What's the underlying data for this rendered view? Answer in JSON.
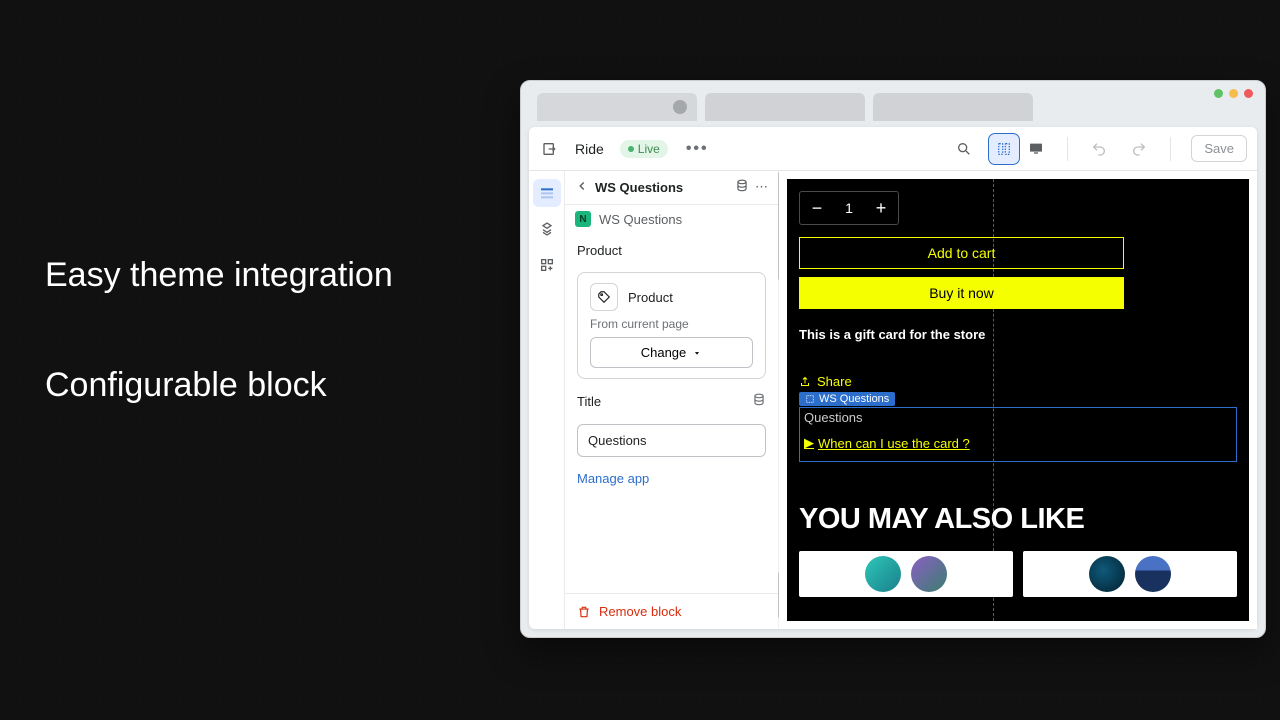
{
  "marketing": {
    "line1": "Easy theme integration",
    "line2": "Configurable block"
  },
  "toolbar": {
    "theme_name": "Ride",
    "status_label": "Live",
    "save_label": "Save"
  },
  "panel": {
    "title": "WS Questions",
    "app_name": "WS Questions",
    "product_section": "Product",
    "product_type": "Product",
    "product_hint": "From current page",
    "change_label": "Change",
    "title_section": "Title",
    "title_value": "Questions",
    "manage_link": "Manage app",
    "remove_label": "Remove block"
  },
  "preview": {
    "qty_value": "1",
    "add_to_cart": "Add to cart",
    "buy_now": "Buy it now",
    "description": "This is a gift card for the store",
    "share_label": "Share",
    "ws_tag": "WS Questions",
    "questions_heading": "Questions",
    "sample_question": "When can I use the card ?",
    "you_may_also": "YOU MAY ALSO LIKE"
  }
}
